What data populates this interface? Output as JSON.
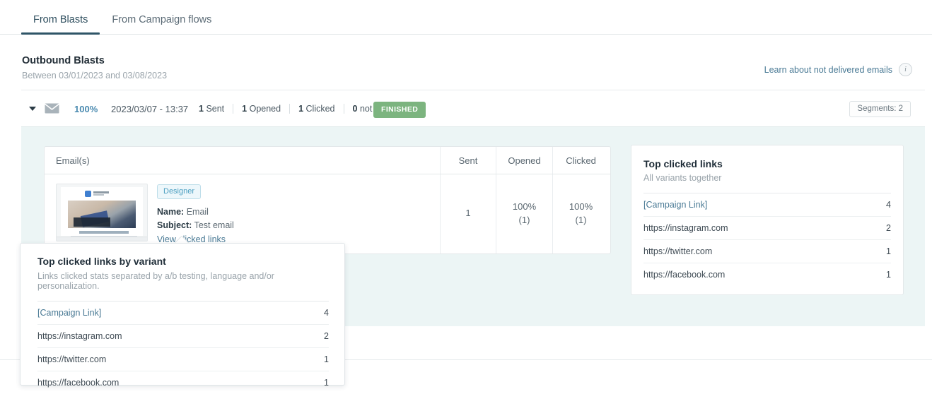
{
  "tabs": [
    {
      "label": "From Blasts",
      "active": true
    },
    {
      "label": "From Campaign flows",
      "active": false
    }
  ],
  "header": {
    "title": "Outbound Blasts",
    "subtitle": "Between 03/01/2023 and 03/08/2023",
    "learn_link": "Learn about not delivered emails",
    "info_icon": "info-icon",
    "info_glyph": "i"
  },
  "blast": {
    "caret_icon": "chevron-down-icon",
    "envelope_icon": "envelope-icon",
    "percent": "100%",
    "date": "2023/03/07 - 13:37",
    "stats": [
      {
        "value": "1",
        "label": "Sent"
      },
      {
        "value": "1",
        "label": "Opened"
      },
      {
        "value": "1",
        "label": "Clicked"
      },
      {
        "value": "0",
        "label": "not sent"
      }
    ],
    "status": "FINISHED",
    "segments": "Segments: 2"
  },
  "email_table": {
    "columns": [
      "Email(s)",
      "Sent",
      "Opened",
      "Clicked"
    ],
    "row": {
      "badge": "Designer",
      "name_label": "Name:",
      "name_value": "Email",
      "subject_label": "Subject:",
      "subject_value": "Test email",
      "view_links": "View clicked links",
      "sent": "1",
      "opened_pct": "100%",
      "opened_count": "(1)",
      "clicked_pct": "100%",
      "clicked_count": "(1)"
    }
  },
  "top_clicked": {
    "title": "Top clicked links",
    "subtitle": "All variants together",
    "links": [
      {
        "name": "[Campaign Link]",
        "count": "4",
        "is_link": true
      },
      {
        "name": "https://instagram.com",
        "count": "2",
        "is_link": false
      },
      {
        "name": "https://twitter.com",
        "count": "1",
        "is_link": false
      },
      {
        "name": "https://facebook.com",
        "count": "1",
        "is_link": false
      }
    ]
  },
  "popover": {
    "title": "Top clicked links by variant",
    "subtitle": "Links clicked stats separated by a/b testing, language and/or personalization.",
    "links": [
      {
        "name": "[Campaign Link]",
        "count": "4",
        "is_link": true
      },
      {
        "name": "https://instagram.com",
        "count": "2",
        "is_link": false
      },
      {
        "name": "https://twitter.com",
        "count": "1",
        "is_link": false
      },
      {
        "name": "https://facebook.com",
        "count": "1",
        "is_link": false
      }
    ]
  },
  "colors": {
    "accent": "#2f5567",
    "link": "#4a7a95",
    "status_green": "#7cb47f",
    "panel_bg": "#ecf5f5",
    "badge_blue": "#4a9ec0"
  }
}
